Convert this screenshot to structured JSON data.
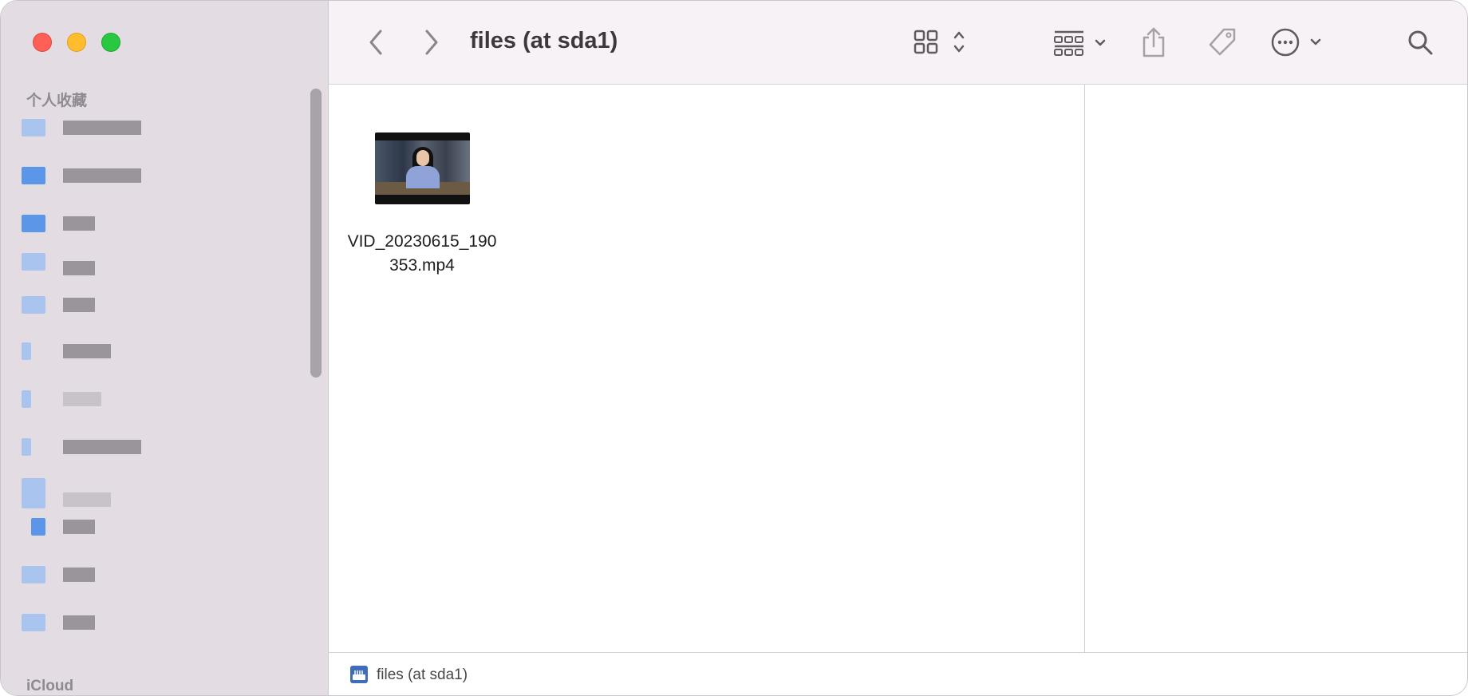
{
  "window": {
    "title": "files (at sda1)"
  },
  "sidebar": {
    "favorites_label": "个人收藏",
    "icloud_label": "iCloud"
  },
  "toolbar": {
    "back_icon": "chevron-left-icon",
    "forward_icon": "chevron-right-icon",
    "view_icon": "grid-view-icon",
    "group_icon": "group-by-icon",
    "share_icon": "share-icon",
    "tag_icon": "tag-icon",
    "more_icon": "ellipsis-circle-icon",
    "search_icon": "search-icon"
  },
  "content": {
    "files": [
      {
        "name": "VID_20230615_190353.mp4",
        "kind": "video"
      }
    ]
  },
  "pathbar": {
    "label": "files (at sda1)",
    "icon": "external-drive-icon"
  }
}
